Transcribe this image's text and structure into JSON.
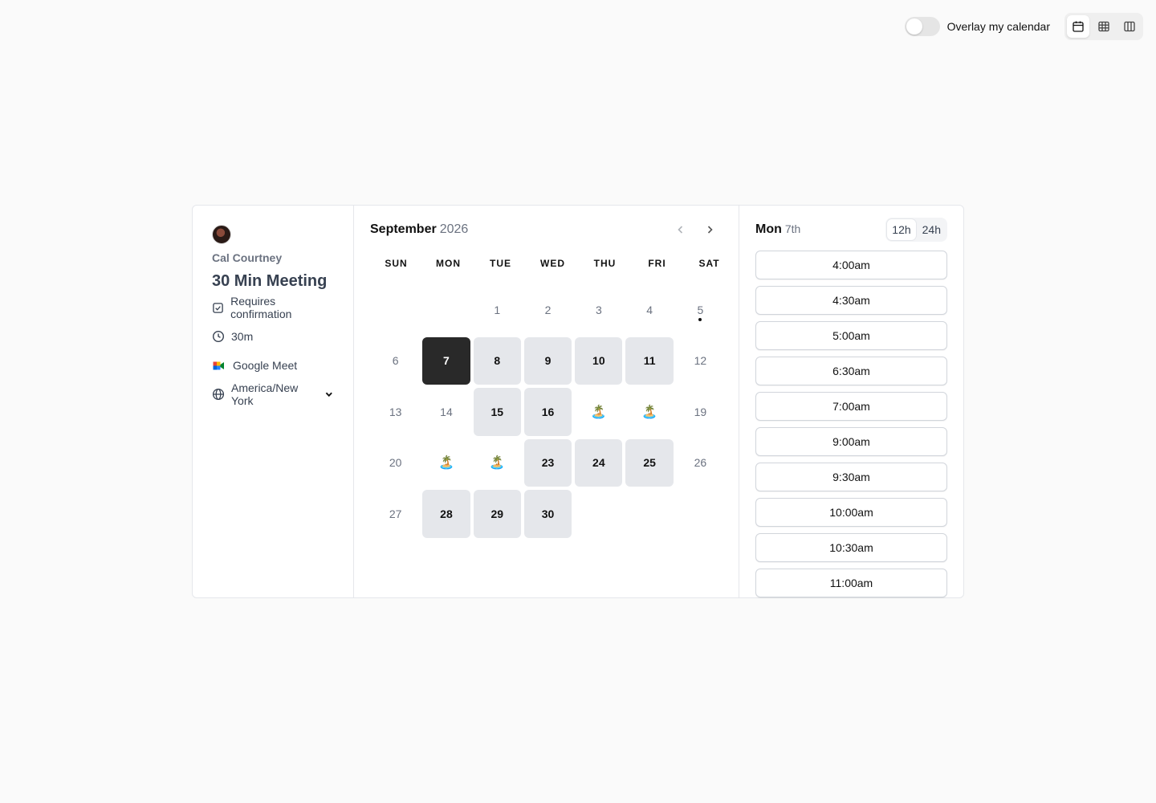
{
  "topbar": {
    "overlay_label": "Overlay my calendar",
    "overlay_on": false,
    "views": [
      {
        "name": "month-view",
        "icon": "calendar-icon",
        "active": true
      },
      {
        "name": "week-view",
        "icon": "grid-icon",
        "active": false
      },
      {
        "name": "column-view",
        "icon": "columns-icon",
        "active": false
      }
    ]
  },
  "event": {
    "host": "Cal Courtney",
    "title": "30 Min Meeting",
    "requires_confirmation": "Requires confirmation",
    "duration": "30m",
    "location": "Google Meet",
    "timezone": "America/New York"
  },
  "calendar": {
    "month": "September",
    "year": "2026",
    "weekdays": [
      "SUN",
      "MON",
      "TUE",
      "WED",
      "THU",
      "FRI",
      "SAT"
    ],
    "days": [
      {
        "label": "",
        "state": "empty"
      },
      {
        "label": "",
        "state": "empty"
      },
      {
        "label": "1",
        "state": "disabled"
      },
      {
        "label": "2",
        "state": "disabled"
      },
      {
        "label": "3",
        "state": "disabled"
      },
      {
        "label": "4",
        "state": "disabled"
      },
      {
        "label": "5",
        "state": "today"
      },
      {
        "label": "6",
        "state": "disabled"
      },
      {
        "label": "7",
        "state": "selected"
      },
      {
        "label": "8",
        "state": "available"
      },
      {
        "label": "9",
        "state": "available"
      },
      {
        "label": "10",
        "state": "available"
      },
      {
        "label": "11",
        "state": "available"
      },
      {
        "label": "12",
        "state": "disabled"
      },
      {
        "label": "13",
        "state": "disabled"
      },
      {
        "label": "14",
        "state": "disabled"
      },
      {
        "label": "15",
        "state": "available"
      },
      {
        "label": "16",
        "state": "available"
      },
      {
        "label": "🏝️",
        "state": "ooo"
      },
      {
        "label": "🏝️",
        "state": "ooo"
      },
      {
        "label": "19",
        "state": "disabled"
      },
      {
        "label": "20",
        "state": "disabled"
      },
      {
        "label": "🏝️",
        "state": "ooo"
      },
      {
        "label": "🏝️",
        "state": "ooo"
      },
      {
        "label": "23",
        "state": "available"
      },
      {
        "label": "24",
        "state": "available"
      },
      {
        "label": "25",
        "state": "available"
      },
      {
        "label": "26",
        "state": "disabled"
      },
      {
        "label": "27",
        "state": "disabled"
      },
      {
        "label": "28",
        "state": "available"
      },
      {
        "label": "29",
        "state": "available"
      },
      {
        "label": "30",
        "state": "available"
      }
    ]
  },
  "slots": {
    "day_name": "Mon",
    "day_num": "7th",
    "format_12": "12h",
    "format_24": "24h",
    "active_format": "12h",
    "times": [
      "4:00am",
      "4:30am",
      "5:00am",
      "6:30am",
      "7:00am",
      "9:00am",
      "9:30am",
      "10:00am",
      "10:30am",
      "11:00am"
    ]
  }
}
